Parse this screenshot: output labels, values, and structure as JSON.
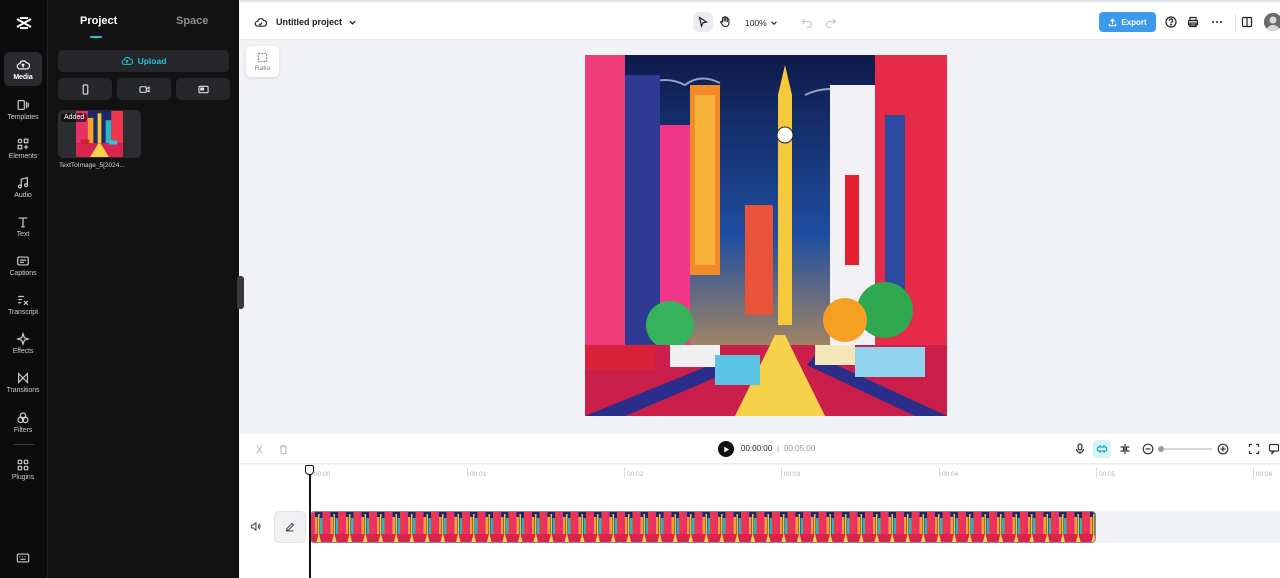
{
  "colors": {
    "accent": "#22c3d8",
    "export": "#3c9aec",
    "rail_bg": "#0c0c0c",
    "panel_bg": "#121212"
  },
  "rail": {
    "logo_icon": "capcut-logo-icon",
    "items": [
      {
        "label": "Media",
        "icon": "cloud-icon"
      },
      {
        "label": "Templates",
        "icon": "templates-icon"
      },
      {
        "label": "Elements",
        "icon": "elements-icon"
      },
      {
        "label": "Audio",
        "icon": "music-note-icon"
      },
      {
        "label": "Text",
        "icon": "text-icon"
      },
      {
        "label": "Captions",
        "icon": "captions-icon"
      },
      {
        "label": "Transcript",
        "icon": "transcript-icon"
      },
      {
        "label": "Effects",
        "icon": "effects-icon"
      },
      {
        "label": "Transitions",
        "icon": "transitions-icon"
      },
      {
        "label": "Filters",
        "icon": "filters-icon"
      },
      {
        "label": "Plugins",
        "icon": "plugins-icon"
      }
    ],
    "bottom_icon": "keyboard-icon"
  },
  "panel": {
    "tabs": [
      "Project",
      "Space"
    ],
    "upload_label": "Upload",
    "filter_icons": [
      "phone-icon",
      "camera-icon",
      "screen-icon"
    ],
    "media": [
      {
        "name": "TextToImage_5[2024...",
        "badge": "Added"
      }
    ]
  },
  "topbar": {
    "project_title": "Untitled project",
    "zoom": "100%",
    "export_label": "Export"
  },
  "canvas": {
    "ratio_label": "Ratio"
  },
  "playback": {
    "current_time": "00:00:00",
    "separator": "|",
    "total_time": "00:05:00"
  },
  "timeline": {
    "ticks": [
      "00:00",
      "00:01",
      "00:02",
      "00:03",
      "00:04",
      "00:05",
      "00:06"
    ]
  }
}
